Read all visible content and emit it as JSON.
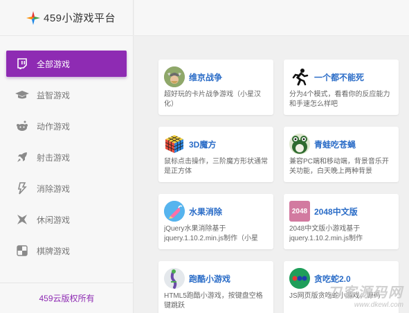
{
  "brand": {
    "title": "459小游戏平台"
  },
  "sidebar": {
    "items": [
      {
        "label": "全部游戏",
        "icon": "twitch-icon",
        "active": true
      },
      {
        "label": "益智游戏",
        "icon": "graduation-cap-icon"
      },
      {
        "label": "动作游戏",
        "icon": "reddit-icon"
      },
      {
        "label": "射击游戏",
        "icon": "rocket-icon"
      },
      {
        "label": "消除游戏",
        "icon": "bolt-icon"
      },
      {
        "label": "休闲游戏",
        "icon": "leaf-icon"
      },
      {
        "label": "棋牌游戏",
        "icon": "chess-board-icon"
      }
    ],
    "footer": "459云版权所有"
  },
  "games": [
    {
      "title": "维京战争",
      "desc": "超好玩的卡片战争游戏（小星汉化）",
      "thumb": "viking-thumb"
    },
    {
      "title": "一个都不能死",
      "desc": "分为4个模式，看看你的反应能力和手速怎么样吧",
      "thumb": "runner-thumb"
    },
    {
      "title": "3D魔方",
      "desc": "鼠标点击操作，三阶魔方形状通常是正方体",
      "thumb": "rubiks-cube-thumb"
    },
    {
      "title": "青蛙吃苍蝇",
      "desc": "兼容PC端和移动端，背景音乐开关功能，白天晚上两种背景",
      "thumb": "frog-thumb"
    },
    {
      "title": "水果消除",
      "desc": "jQuery水果消除基于jquery.1.10.2.min.js制作（小星美...",
      "thumb": "fruit-thumb"
    },
    {
      "title": "2048中文版",
      "desc": "2048中文版小游戏基于jquery.1.10.2.min.js制作",
      "thumb": "2048-thumb",
      "thumb_text": "2048"
    },
    {
      "title": "跑酷小游戏",
      "desc": "HTML5跑酷小游戏，按键盘空格键跳跃",
      "thumb": "parkour-thumb"
    },
    {
      "title": "贪吃蛇2.0",
      "desc": "JS网页版贪吃蛇小游戏，源码",
      "thumb": "snake-thumb"
    }
  ],
  "watermark": {
    "big": "刀客源码网",
    "small": "www.dkewl.com"
  },
  "colors": {
    "accent": "#8e2bb3",
    "link": "#2a6cc7"
  }
}
